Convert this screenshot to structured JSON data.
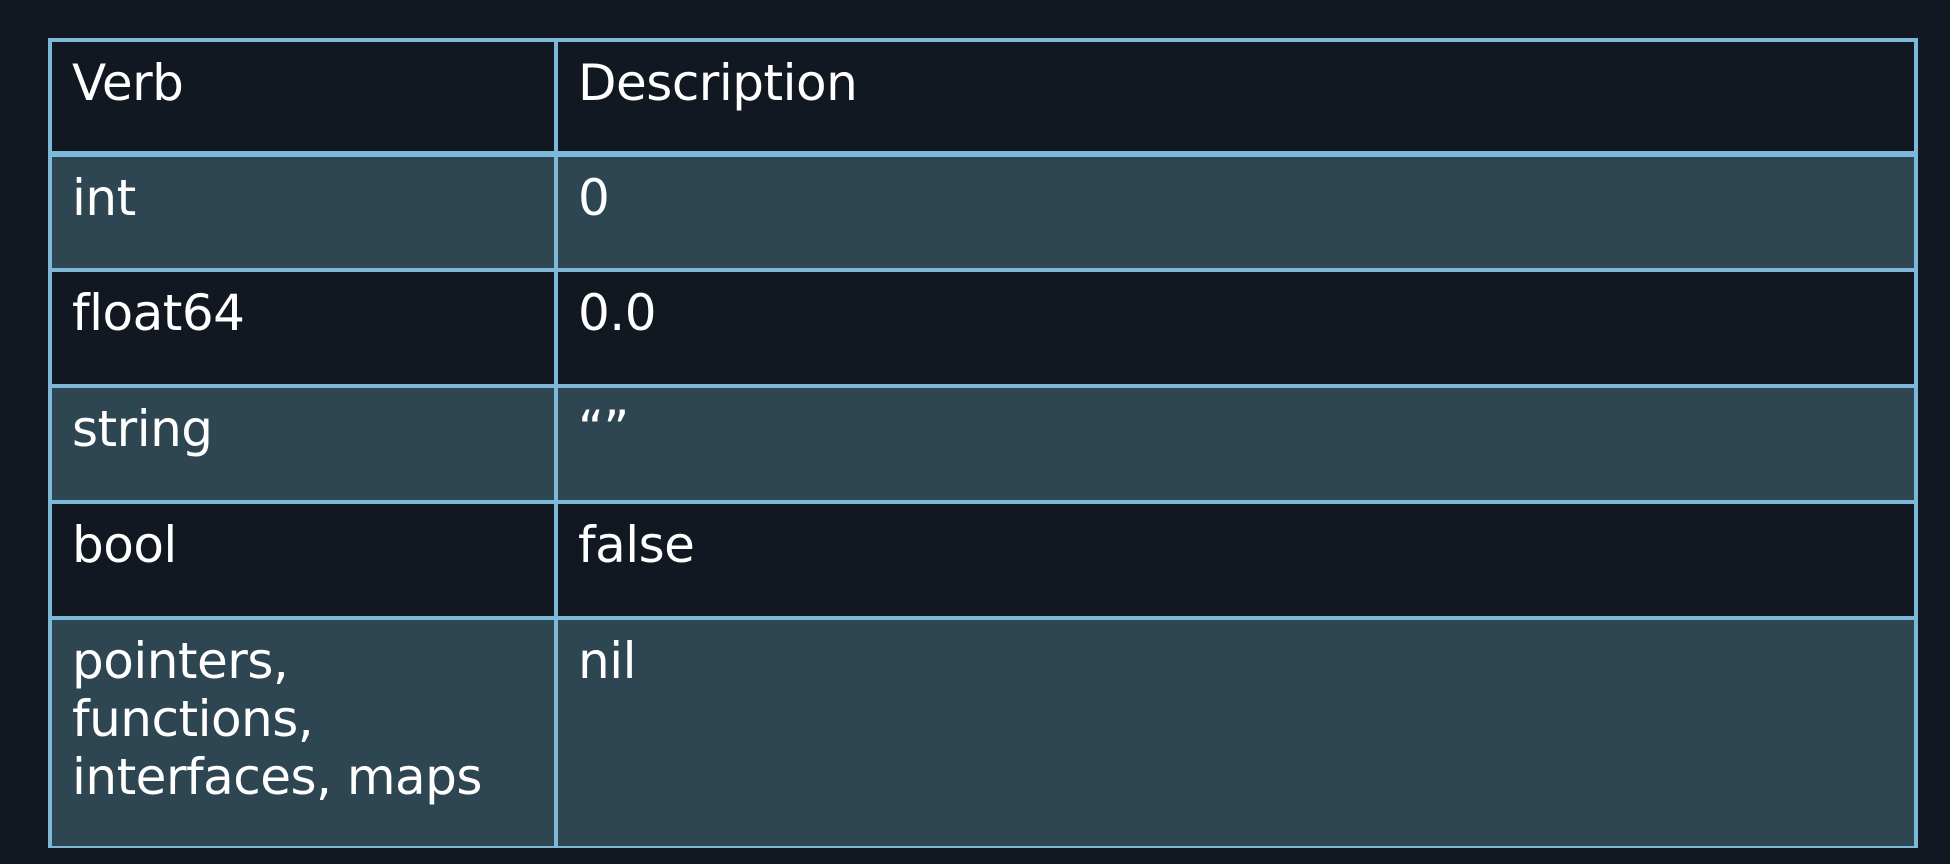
{
  "table": {
    "headers": {
      "verb": "Verb",
      "description": "Description"
    },
    "rows": [
      {
        "verb": "int",
        "description": "0"
      },
      {
        "verb": "float64",
        "description": "0.0"
      },
      {
        "verb": "string",
        "description": "“”"
      },
      {
        "verb": "bool",
        "description": "false"
      },
      {
        "verb": "pointers,\nfunctions,\ninterfaces, maps",
        "description": "nil"
      }
    ]
  },
  "colors": {
    "background": "#121821",
    "border": "#7db8d8",
    "row_dark": "#121821",
    "row_light": "#2e4552",
    "text": "#ffffff"
  }
}
